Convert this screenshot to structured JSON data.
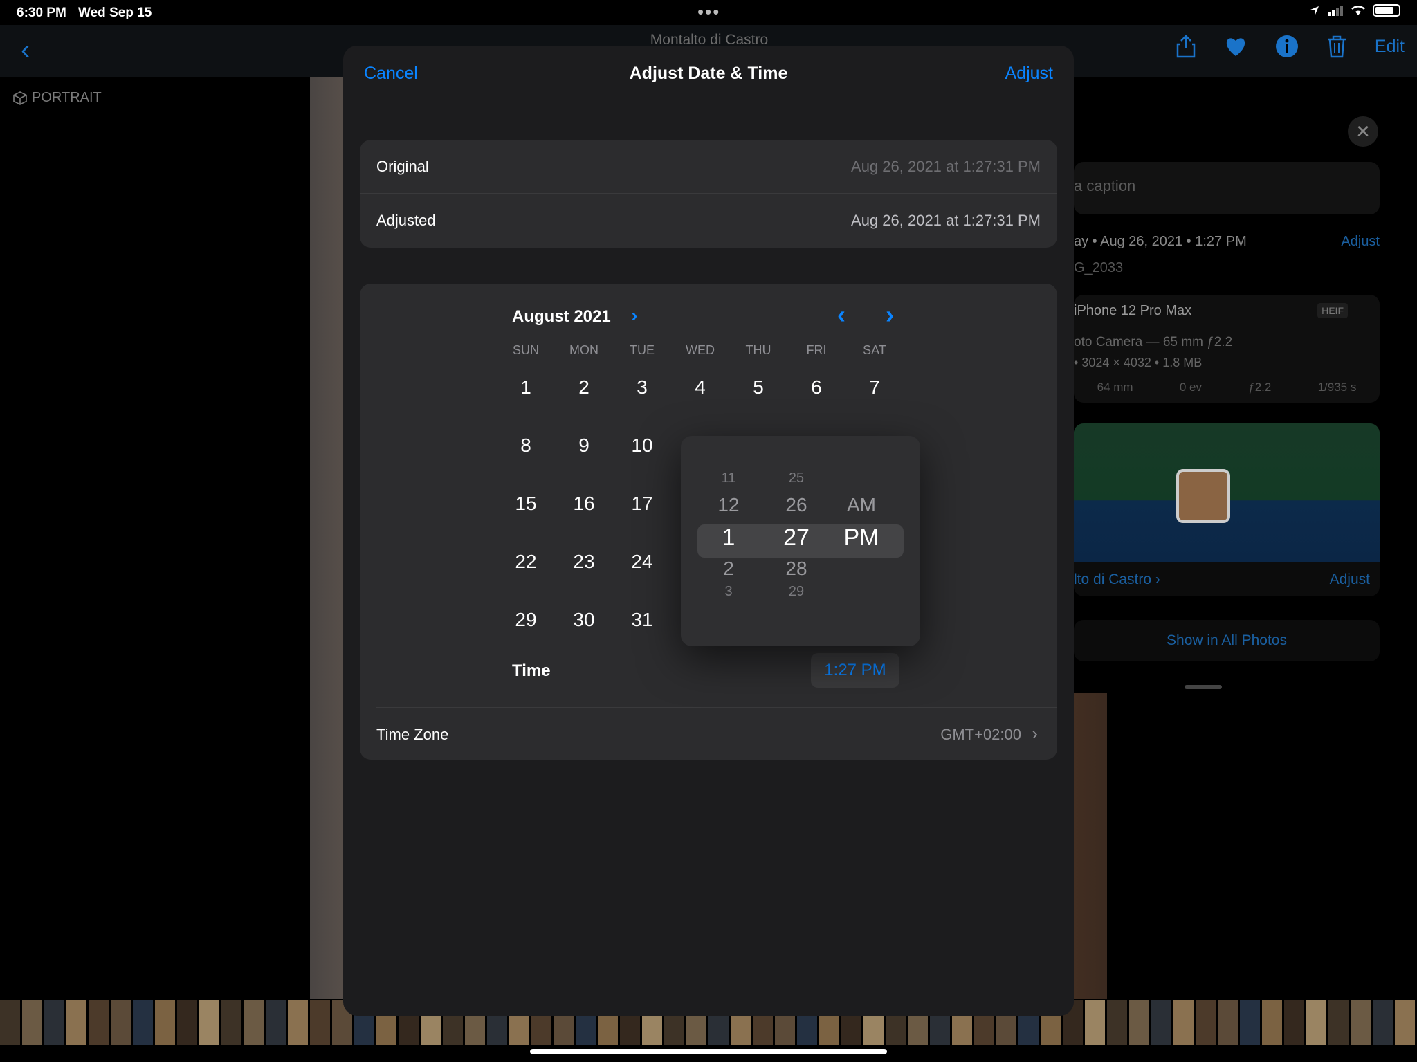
{
  "status": {
    "time": "6:30 PM",
    "date": "Wed Sep 15",
    "dots": "•••"
  },
  "nav": {
    "back": "‹",
    "title": "Montalto di Castro",
    "edit": "Edit"
  },
  "portrait": "PORTRAIT",
  "info": {
    "close": "✕",
    "caption": "a caption",
    "date": "ay • Aug 26, 2021 • 1:27 PM",
    "adjust": "Adjust",
    "file": "G_2033",
    "model": "iPhone 12 Pro Max",
    "heif": "HEIF",
    "lens": "oto Camera — 65 mm ƒ2.2",
    "res": "•  3024 × 4032  •  1.8 MB",
    "specs": [
      "64 mm",
      "0 ev",
      "ƒ2.2",
      "1/935 s"
    ],
    "location": "lto di Castro ›",
    "location_adjust": "Adjust",
    "show_all": "Show in All Photos"
  },
  "modal": {
    "cancel": "Cancel",
    "title": "Adjust Date & Time",
    "adjust": "Adjust",
    "original_label": "Original",
    "original_value": "Aug 26, 2021 at 1:27:31 PM",
    "adjusted_label": "Adjusted",
    "adjusted_value": "Aug 26, 2021 at 1:27:31 PM",
    "month": "August 2021",
    "month_chevron": "›",
    "prev": "‹",
    "next": "›",
    "weekdays": [
      "SUN",
      "MON",
      "TUE",
      "WED",
      "THU",
      "FRI",
      "SAT"
    ],
    "days": [
      [
        "1",
        "2",
        "3",
        "4",
        "5",
        "6",
        "7"
      ],
      [
        "8",
        "9",
        "10",
        "",
        "",
        "",
        ""
      ],
      [
        "15",
        "16",
        "17",
        "",
        "",
        "",
        ""
      ],
      [
        "22",
        "23",
        "24",
        "",
        "",
        "",
        ""
      ],
      [
        "29",
        "30",
        "31",
        "",
        "",
        "",
        ""
      ]
    ],
    "time_label": "Time",
    "time_value": "1:27 PM",
    "tz_label": "Time Zone",
    "tz_value": "GMT+02:00",
    "tz_chevron": "›"
  },
  "picker": {
    "hours": [
      "11",
      "12",
      "1",
      "2",
      "3"
    ],
    "minutes": [
      "25",
      "26",
      "27",
      "28",
      "29"
    ],
    "ampm": [
      "AM",
      "PM"
    ]
  },
  "colors": {
    "accent": "#0a84ff",
    "modal_bg": "#1c1c1e",
    "group_bg": "#2c2c2e"
  }
}
